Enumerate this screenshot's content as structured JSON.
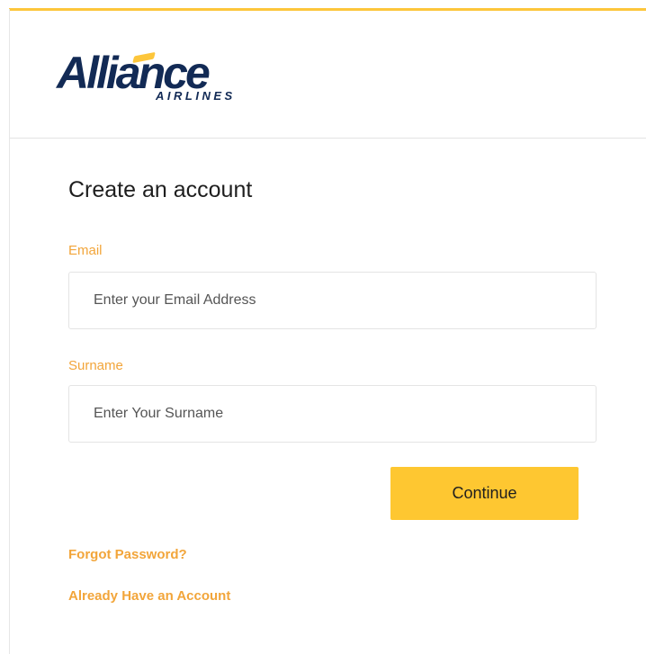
{
  "brand": {
    "logo_text": "Alliance",
    "logo_subtext": "AIRLINES",
    "primary_color": "#122a55",
    "accent_color": "#fdc63b"
  },
  "form": {
    "title": "Create an account",
    "email": {
      "label": "Email",
      "value": "",
      "placeholder": "Enter your Email Address"
    },
    "surname": {
      "label": "Surname",
      "value": "",
      "placeholder": "Enter Your Surname"
    },
    "continue_label": "Continue",
    "label_color": "#f2a53a",
    "button_color": "#fec731"
  },
  "links": {
    "forgot_password": "Forgot Password?",
    "already_have_account": "Already Have an Account"
  }
}
